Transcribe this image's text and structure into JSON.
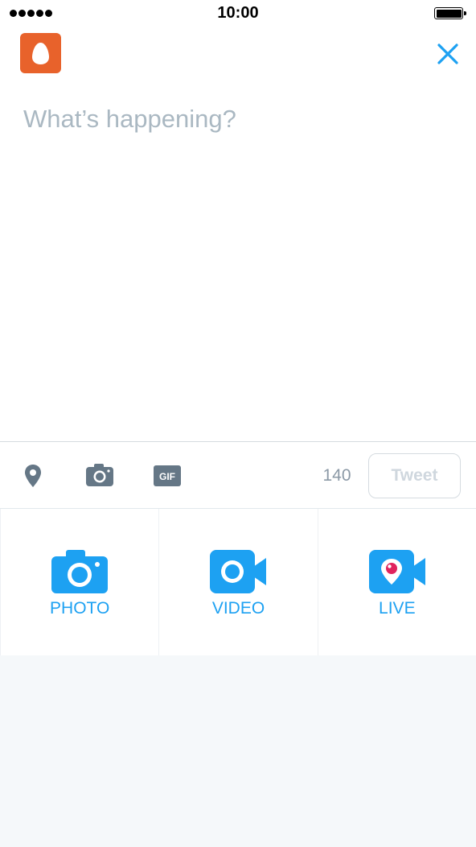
{
  "status_bar": {
    "time": "10:00",
    "signal_dots": 5
  },
  "header": {
    "avatar_icon": "egg-avatar-icon",
    "close_icon": "close-icon"
  },
  "compose": {
    "placeholder": "What’s happening?",
    "value": ""
  },
  "toolbar": {
    "icons": [
      "location-pin-icon",
      "camera-icon",
      "gif-icon"
    ],
    "gif_label": "GIF",
    "char_count": "140",
    "tweet_label": "Tweet"
  },
  "media": {
    "photo_label": "PHOTO",
    "video_label": "VIDEO",
    "live_label": "LIVE"
  },
  "colors": {
    "accent": "#1da1f2",
    "avatar_bg": "#e8622b",
    "placeholder": "#aab8c2",
    "icon_gray": "#657786",
    "background_gray": "#f5f8fa"
  }
}
